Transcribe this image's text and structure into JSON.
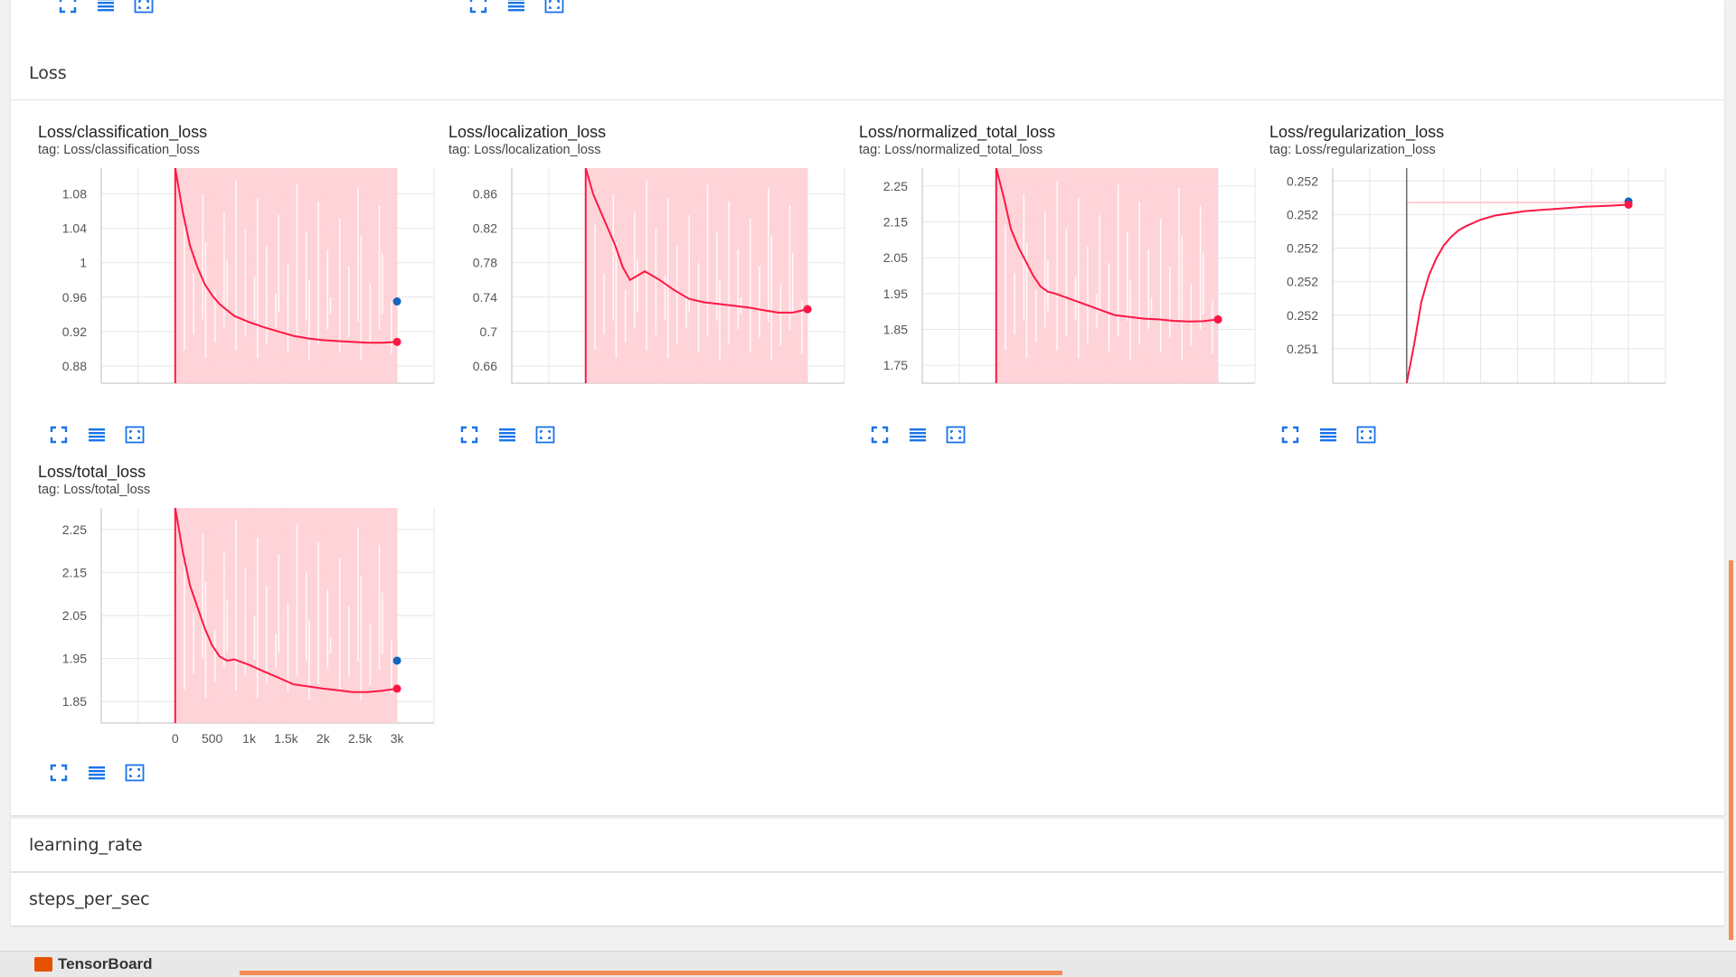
{
  "sections": {
    "loss": "Loss",
    "learning_rate": "learning_rate",
    "steps_per_sec": "steps_per_sec"
  },
  "app": {
    "name": "TensorBoard"
  },
  "colors": {
    "smoothed": "#ff0000",
    "raw_fill": "#ffcdd2",
    "dot_blue": "#1565c0",
    "accent": "#f28b55"
  },
  "icons": [
    "fullscreen-icon",
    "toggle-log-scale-icon",
    "fit-domain-icon"
  ],
  "chart_data": [
    {
      "type": "line",
      "title": "Loss/classification_loss",
      "tag": "tag: Loss/classification_loss",
      "xlim": [
        -1000,
        3500
      ],
      "ylim": [
        0.86,
        1.11
      ],
      "yticks": [
        0.88,
        0.92,
        0.96,
        1.0,
        1.04,
        1.08
      ],
      "ytick_labels": [
        "0.88",
        "0.92",
        "0.96",
        "1",
        "1.04",
        "1.08"
      ],
      "x": [
        0,
        100,
        200,
        300,
        400,
        500,
        600,
        700,
        800,
        1000,
        1200,
        1400,
        1600,
        1800,
        2000,
        2200,
        2400,
        2600,
        2800,
        3000
      ],
      "series": [
        {
          "values": [
            1.12,
            1.06,
            1.02,
            0.995,
            0.975,
            0.962,
            0.952,
            0.945,
            0.938,
            0.931,
            0.925,
            0.92,
            0.915,
            0.912,
            0.91,
            0.909,
            0.908,
            0.907,
            0.907,
            0.908
          ]
        }
      ],
      "last_raw": 0.955
    },
    {
      "type": "line",
      "title": "Loss/localization_loss",
      "tag": "tag: Loss/localization_loss",
      "xlim": [
        -1000,
        3500
      ],
      "ylim": [
        0.64,
        0.89
      ],
      "yticks": [
        0.66,
        0.7,
        0.74,
        0.78,
        0.82,
        0.86
      ],
      "ytick_labels": [
        "0.66",
        "0.7",
        "0.74",
        "0.78",
        "0.82",
        "0.86"
      ],
      "x": [
        0,
        100,
        200,
        300,
        400,
        500,
        600,
        700,
        800,
        1000,
        1200,
        1400,
        1600,
        1800,
        2000,
        2200,
        2400,
        2600,
        2800,
        3000
      ],
      "series": [
        {
          "values": [
            0.9,
            0.86,
            0.84,
            0.82,
            0.8,
            0.775,
            0.76,
            0.765,
            0.77,
            0.76,
            0.748,
            0.738,
            0.734,
            0.732,
            0.73,
            0.728,
            0.725,
            0.722,
            0.722,
            0.726
          ]
        }
      ],
      "last_raw": 0.726
    },
    {
      "type": "line",
      "title": "Loss/normalized_total_loss",
      "tag": "tag: Loss/normalized_total_loss",
      "xlim": [
        -1000,
        3500
      ],
      "ylim": [
        1.7,
        2.3
      ],
      "yticks": [
        1.75,
        1.85,
        1.95,
        2.05,
        2.15,
        2.25
      ],
      "ytick_labels": [
        "1.75",
        "1.85",
        "1.95",
        "2.05",
        "2.15",
        "2.25"
      ],
      "x": [
        0,
        100,
        200,
        300,
        400,
        500,
        600,
        700,
        800,
        1000,
        1200,
        1400,
        1600,
        1800,
        2000,
        2200,
        2400,
        2600,
        2800,
        3000
      ],
      "series": [
        {
          "values": [
            2.3,
            2.22,
            2.13,
            2.08,
            2.04,
            2.0,
            1.97,
            1.955,
            1.95,
            1.935,
            1.92,
            1.905,
            1.89,
            1.885,
            1.88,
            1.878,
            1.874,
            1.872,
            1.873,
            1.878
          ]
        }
      ],
      "last_raw": 1.878
    },
    {
      "type": "line",
      "title": "Loss/regularization_loss",
      "tag": "tag: Loss/regularization_loss",
      "xlim": [
        -1000,
        3500
      ],
      "ylim": [
        0,
        1
      ],
      "ytick_labels": [
        "0.252",
        "0.252",
        "0.252",
        "0.252",
        "0.252",
        "0.251"
      ],
      "x": [
        0,
        100,
        200,
        300,
        400,
        500,
        600,
        700,
        800,
        1000,
        1200,
        1400,
        1600,
        1800,
        2000,
        2200,
        2400,
        2600,
        2800,
        3000
      ],
      "series": [
        {
          "values": [
            0.0,
            0.18,
            0.38,
            0.5,
            0.58,
            0.64,
            0.68,
            0.71,
            0.73,
            0.76,
            0.78,
            0.79,
            0.8,
            0.805,
            0.81,
            0.815,
            0.82,
            0.823,
            0.826,
            0.83
          ]
        }
      ],
      "raw_level": 0.84,
      "last_raw": 0.845
    },
    {
      "type": "line",
      "title": "Loss/total_loss",
      "tag": "tag: Loss/total_loss",
      "xlim": [
        -1000,
        3500
      ],
      "ylim": [
        1.8,
        2.3
      ],
      "yticks": [
        1.85,
        1.95,
        2.05,
        2.15,
        2.25
      ],
      "ytick_labels": [
        "1.85",
        "1.95",
        "2.05",
        "2.15",
        "2.25"
      ],
      "xticks": [
        0,
        500,
        1000,
        1500,
        2000,
        2500,
        3000
      ],
      "xtick_labels": [
        "0",
        "500",
        "1k",
        "1.5k",
        "2k",
        "2.5k",
        "3k"
      ],
      "x": [
        0,
        100,
        200,
        300,
        400,
        500,
        600,
        700,
        800,
        1000,
        1200,
        1400,
        1600,
        1800,
        2000,
        2200,
        2400,
        2600,
        2800,
        3000
      ],
      "series": [
        {
          "values": [
            2.3,
            2.2,
            2.12,
            2.07,
            2.02,
            1.98,
            1.955,
            1.945,
            1.948,
            1.935,
            1.92,
            1.905,
            1.89,
            1.885,
            1.88,
            1.876,
            1.872,
            1.872,
            1.875,
            1.88
          ]
        }
      ],
      "last_raw": 1.945
    }
  ]
}
